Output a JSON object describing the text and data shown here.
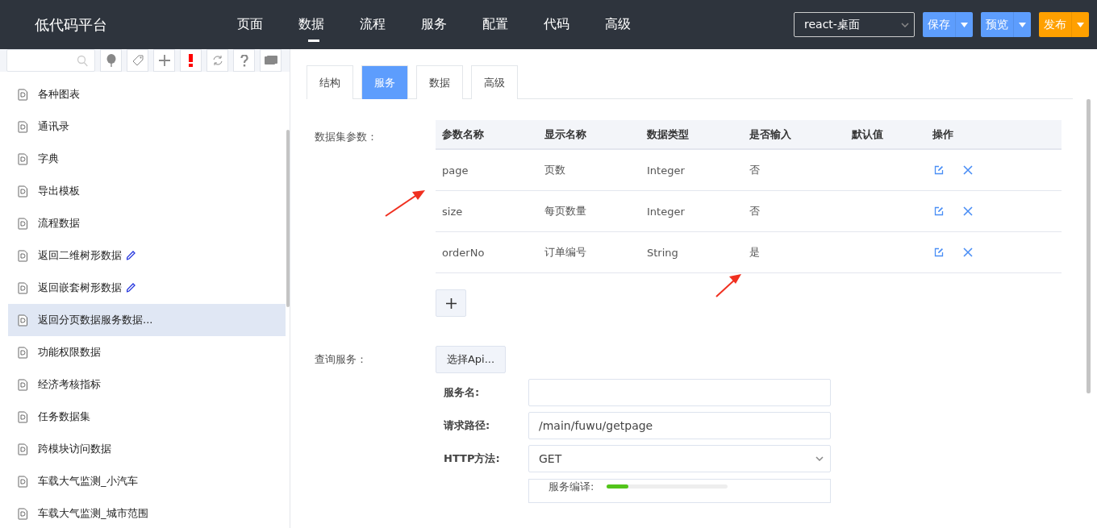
{
  "app_title": "低代码平台",
  "nav": [
    {
      "label": "页面",
      "selected": false
    },
    {
      "label": "数据",
      "selected": true
    },
    {
      "label": "流程",
      "selected": false
    },
    {
      "label": "服务",
      "selected": false
    },
    {
      "label": "配置",
      "selected": false
    },
    {
      "label": "代码",
      "selected": false
    },
    {
      "label": "高级",
      "selected": false
    }
  ],
  "platform_select": {
    "value": "react-桌面"
  },
  "actions": [
    {
      "label": "保存",
      "kind": "primary"
    },
    {
      "label": "预览",
      "kind": "primary"
    },
    {
      "label": "发布",
      "kind": "warning"
    }
  ],
  "sidebar": {
    "items": [
      {
        "label": "各种图表",
        "selected": false,
        "edited": false
      },
      {
        "label": "通讯录",
        "selected": false,
        "edited": false
      },
      {
        "label": "字典",
        "selected": false,
        "edited": false
      },
      {
        "label": "导出模板",
        "selected": false,
        "edited": false
      },
      {
        "label": "流程数据",
        "selected": false,
        "edited": false
      },
      {
        "label": "返回二维树形数据",
        "selected": false,
        "edited": true
      },
      {
        "label": "返回嵌套树形数据",
        "selected": false,
        "edited": true
      },
      {
        "label": "返回分页数据服务数据...",
        "selected": true,
        "edited": false
      },
      {
        "label": "功能权限数据",
        "selected": false,
        "edited": false
      },
      {
        "label": "经济考核指标",
        "selected": false,
        "edited": false
      },
      {
        "label": "任务数据集",
        "selected": false,
        "edited": false
      },
      {
        "label": "跨模块访问数据",
        "selected": false,
        "edited": false
      },
      {
        "label": "车载大气监测_小汽车",
        "selected": false,
        "edited": false
      },
      {
        "label": "车载大气监测_城市范围",
        "selected": false,
        "edited": false
      }
    ]
  },
  "tabs": [
    {
      "label": "结构",
      "selected": false
    },
    {
      "label": "服务",
      "selected": true
    },
    {
      "label": "数据",
      "selected": false
    },
    {
      "label": "高级",
      "selected": false
    }
  ],
  "params": {
    "label": "数据集参数：",
    "columns": [
      "参数名称",
      "显示名称",
      "数据类型",
      "是否输入",
      "默认值",
      "操作"
    ],
    "rows": [
      {
        "name": "page",
        "display": "页数",
        "type": "Integer",
        "input": "否"
      },
      {
        "name": "size",
        "display": "每页数量",
        "type": "Integer",
        "input": "否"
      },
      {
        "name": "orderNo",
        "display": "订单编号",
        "type": "String",
        "input": "是"
      }
    ]
  },
  "query": {
    "label": "查询服务：",
    "choose_button": "选择Api...",
    "fields": [
      {
        "label": "服务名:",
        "kind": "text"
      },
      {
        "label": "请求路径:",
        "kind": "text",
        "value": "/main/fuwu/getpage"
      },
      {
        "label": "HTTP方法:",
        "kind": "select",
        "value": "GET"
      }
    ],
    "compile": {
      "label": "服务编译:",
      "level": 0.18
    }
  }
}
